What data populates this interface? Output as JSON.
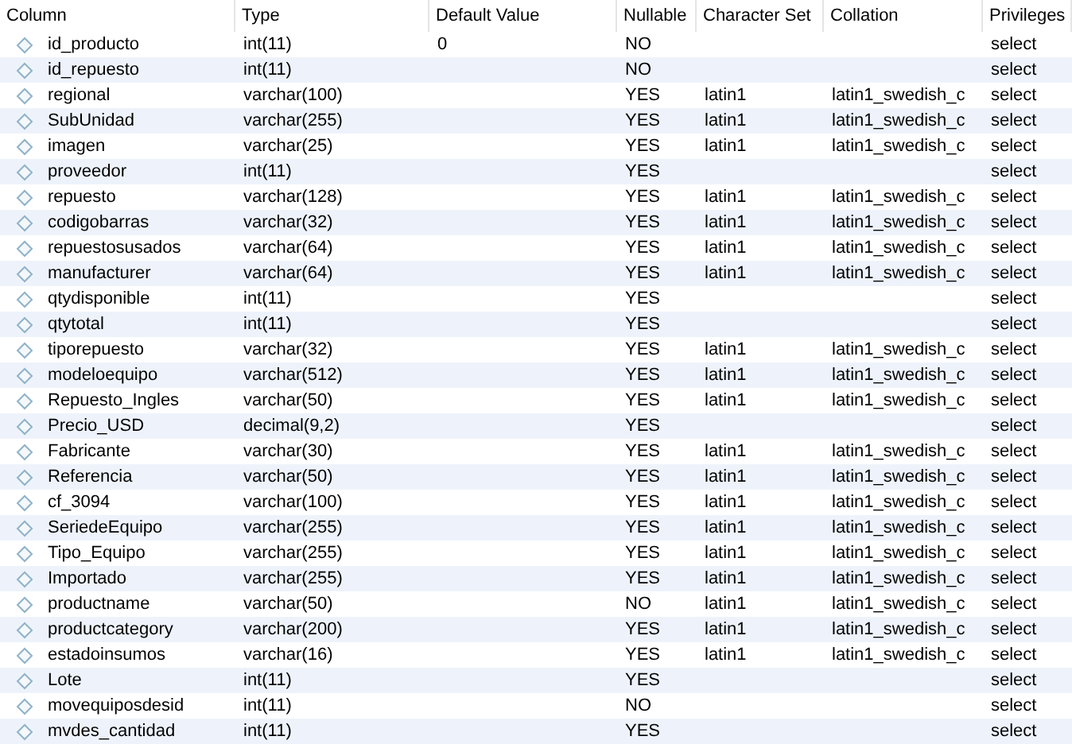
{
  "table": {
    "columns": [
      "Column",
      "Type",
      "Default Value",
      "Nullable",
      "Character Set",
      "Collation",
      "Privileges"
    ],
    "rows": [
      {
        "column": "id_producto",
        "type": "int(11)",
        "default": "0",
        "nullable": "NO",
        "privileges": "select"
      },
      {
        "column": "id_repuesto",
        "type": "int(11)",
        "nullable": "NO",
        "privileges": "select"
      },
      {
        "column": "regional",
        "type": "varchar(100)",
        "nullable": "YES",
        "charset": "latin1",
        "collation": "latin1_swedish_c",
        "privileges": "select"
      },
      {
        "column": "SubUnidad",
        "type": "varchar(255)",
        "nullable": "YES",
        "charset": "latin1",
        "collation": "latin1_swedish_c",
        "privileges": "select"
      },
      {
        "column": "imagen",
        "type": "varchar(25)",
        "nullable": "YES",
        "charset": "latin1",
        "collation": "latin1_swedish_c",
        "privileges": "select"
      },
      {
        "column": "proveedor",
        "type": "int(11)",
        "nullable": "YES",
        "privileges": "select"
      },
      {
        "column": "repuesto",
        "type": "varchar(128)",
        "nullable": "YES",
        "charset": "latin1",
        "collation": "latin1_swedish_c",
        "privileges": "select"
      },
      {
        "column": "codigobarras",
        "type": "varchar(32)",
        "nullable": "YES",
        "charset": "latin1",
        "collation": "latin1_swedish_c",
        "privileges": "select"
      },
      {
        "column": "repuestosusados",
        "type": "varchar(64)",
        "nullable": "YES",
        "charset": "latin1",
        "collation": "latin1_swedish_c",
        "privileges": "select"
      },
      {
        "column": "manufacturer",
        "type": "varchar(64)",
        "nullable": "YES",
        "charset": "latin1",
        "collation": "latin1_swedish_c",
        "privileges": "select"
      },
      {
        "column": "qtydisponible",
        "type": "int(11)",
        "nullable": "YES",
        "privileges": "select"
      },
      {
        "column": "qtytotal",
        "type": "int(11)",
        "nullable": "YES",
        "privileges": "select"
      },
      {
        "column": "tiporepuesto",
        "type": "varchar(32)",
        "nullable": "YES",
        "charset": "latin1",
        "collation": "latin1_swedish_c",
        "privileges": "select"
      },
      {
        "column": "modeloequipo",
        "type": "varchar(512)",
        "nullable": "YES",
        "charset": "latin1",
        "collation": "latin1_swedish_c",
        "privileges": "select"
      },
      {
        "column": "Repuesto_Ingles",
        "type": "varchar(50)",
        "nullable": "YES",
        "charset": "latin1",
        "collation": "latin1_swedish_c",
        "privileges": "select"
      },
      {
        "column": "Precio_USD",
        "type": "decimal(9,2)",
        "nullable": "YES",
        "privileges": "select"
      },
      {
        "column": "Fabricante",
        "type": "varchar(30)",
        "nullable": "YES",
        "charset": "latin1",
        "collation": "latin1_swedish_c",
        "privileges": "select"
      },
      {
        "column": "Referencia",
        "type": "varchar(50)",
        "nullable": "YES",
        "charset": "latin1",
        "collation": "latin1_swedish_c",
        "privileges": "select"
      },
      {
        "column": "cf_3094",
        "type": "varchar(100)",
        "nullable": "YES",
        "charset": "latin1",
        "collation": "latin1_swedish_c",
        "privileges": "select"
      },
      {
        "column": "SeriedeEquipo",
        "type": "varchar(255)",
        "nullable": "YES",
        "charset": "latin1",
        "collation": "latin1_swedish_c",
        "privileges": "select"
      },
      {
        "column": "Tipo_Equipo",
        "type": "varchar(255)",
        "nullable": "YES",
        "charset": "latin1",
        "collation": "latin1_swedish_c",
        "privileges": "select"
      },
      {
        "column": "Importado",
        "type": "varchar(255)",
        "nullable": "YES",
        "charset": "latin1",
        "collation": "latin1_swedish_c",
        "privileges": "select"
      },
      {
        "column": "productname",
        "type": "varchar(50)",
        "nullable": "NO",
        "charset": "latin1",
        "collation": "latin1_swedish_c",
        "privileges": "select"
      },
      {
        "column": "productcategory",
        "type": "varchar(200)",
        "nullable": "YES",
        "charset": "latin1",
        "collation": "latin1_swedish_c",
        "privileges": "select"
      },
      {
        "column": "estadoinsumos",
        "type": "varchar(16)",
        "nullable": "YES",
        "charset": "latin1",
        "collation": "latin1_swedish_c",
        "privileges": "select"
      },
      {
        "column": "Lote",
        "type": "int(11)",
        "nullable": "YES",
        "privileges": "select"
      },
      {
        "column": "movequiposdesid",
        "type": "int(11)",
        "nullable": "NO",
        "privileges": "select"
      },
      {
        "column": "mvdes_cantidad",
        "type": "int(11)",
        "nullable": "YES",
        "privileges": "select"
      }
    ]
  }
}
